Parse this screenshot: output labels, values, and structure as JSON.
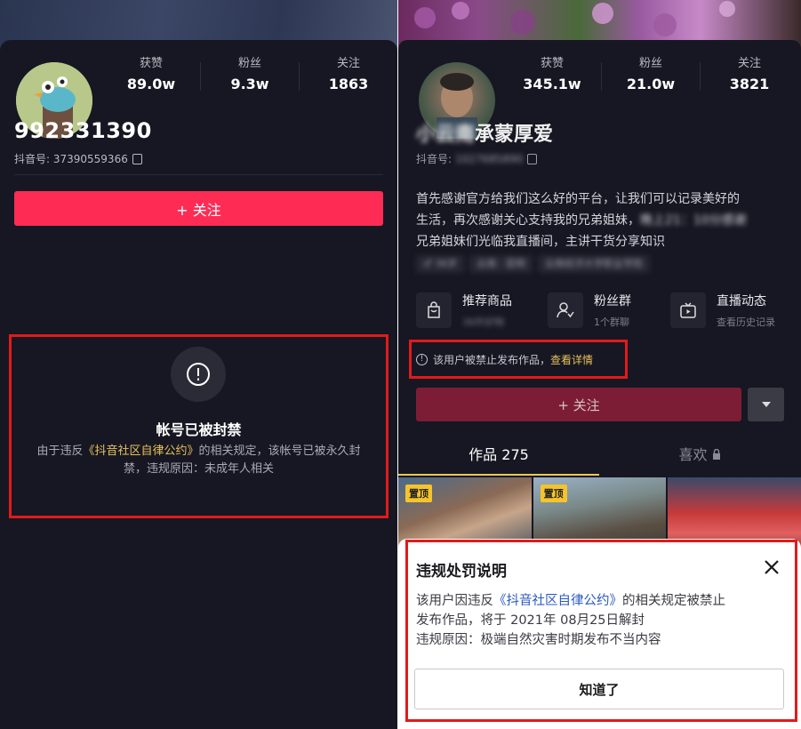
{
  "left": {
    "stats": [
      {
        "label": "获赞",
        "value": "89.0w"
      },
      {
        "label": "粉丝",
        "value": "9.3w"
      },
      {
        "label": "关注",
        "value": "1863"
      }
    ],
    "name": "992331390",
    "douyin_id": "抖音号: 37390559366",
    "follow_label": "+ 关注",
    "ban": {
      "title": "帐号已被封禁",
      "desc_prefix": "由于违反",
      "desc_link": "《抖音社区自律公约》",
      "desc_suffix": "的相关规定，该帐号已被永久封禁，违规原因：未成年人相关"
    }
  },
  "right": {
    "stats": [
      {
        "label": "获赞",
        "value": "345.1w"
      },
      {
        "label": "粉丝",
        "value": "21.0w"
      },
      {
        "label": "关注",
        "value": "3821"
      }
    ],
    "name_blurred": "小云南",
    "name_visible": "承蒙厚爱",
    "douyin_id_label": "抖音号:",
    "douyin_id_blurred": "1027685890",
    "bio_line1": "首先感谢官方给我们这么好的平台，让我们可以记录美好的",
    "bio_line2a": "生活，再次感谢关心支持我的兄弟姐妹，",
    "bio_line2b": "晚上21：10分感谢",
    "bio_line3": "兄弟姐妹们光临我直播间，主讲干货分享知识",
    "tags": [
      "♂ 36岁",
      "云南 · 昆明",
      "云南经济大学职业学院"
    ],
    "features": [
      {
        "title": "推荐商品",
        "sub": "36件好物",
        "icon": "bag-icon"
      },
      {
        "title": "粉丝群",
        "sub": "1个群聊",
        "icon": "fans-group-icon"
      },
      {
        "title": "直播动态",
        "sub": "查看历史记录",
        "icon": "live-icon"
      }
    ],
    "notice_text": "该用户被禁止发布作品，",
    "notice_link": "查看详情",
    "follow_label": "+ 关注",
    "tabs": [
      {
        "label": "作品 275"
      },
      {
        "label": "喜欢"
      }
    ],
    "pin_label": "置顶",
    "modal": {
      "title": "违规处罚说明",
      "line1_prefix": "该用户因违反",
      "line1_link": "《抖音社区自律公约》",
      "line1_suffix": "的相关规定被禁止",
      "line2": "发布作品，将于 2021年 08月25日解封",
      "line3": "违规原因：极端自然灾害时期发布不当内容",
      "ok_label": "知道了"
    }
  },
  "colors": {
    "background": "#161722",
    "accent_red": "#fe2c55",
    "highlight_box": "#e21a1a",
    "gold_link": "#e8c15d",
    "blue_link": "#2b59c3"
  }
}
